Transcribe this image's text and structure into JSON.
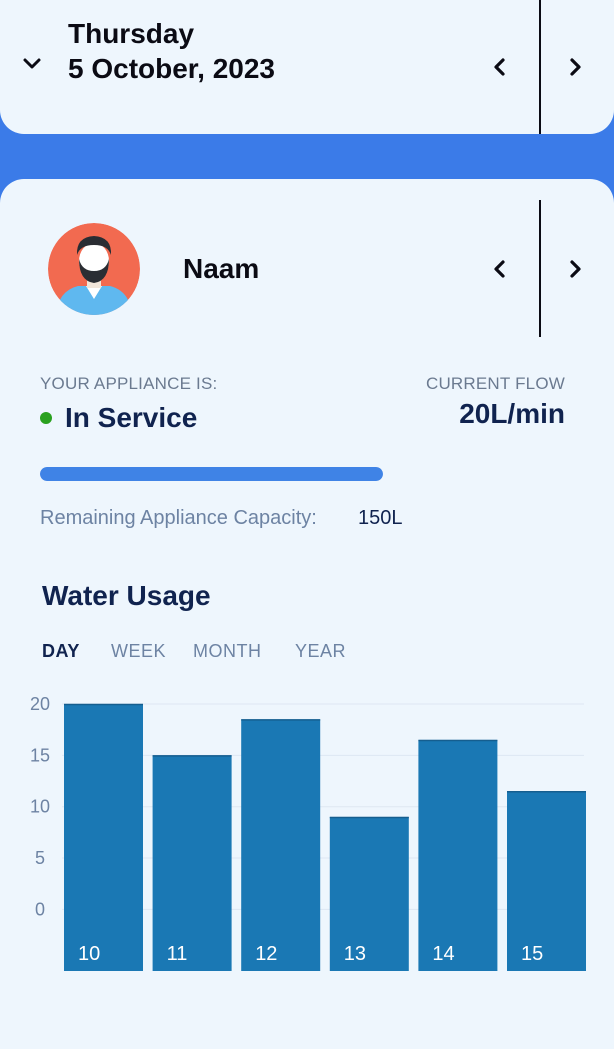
{
  "header": {
    "day": "Thursday",
    "date": "5 October, 2023"
  },
  "user": {
    "name": "Naam"
  },
  "appliance": {
    "status_label": "YOUR APPLIANCE IS:",
    "status": "In Service",
    "status_color": "#2aa11f",
    "flow_label": "CURRENT FLOW",
    "flow_value": "20L/min",
    "capacity_label": "Remaining Appliance Capacity:",
    "capacity_value": "150L",
    "capacity_fraction": 1.0
  },
  "usage": {
    "title": "Water Usage",
    "tabs": [
      "DAY",
      "WEEK",
      "MONTH",
      "YEAR"
    ],
    "active_tab": "DAY"
  },
  "colors": {
    "background": "#3b7be8",
    "card": "#eef6fd",
    "bar": "#1a78b4",
    "heading": "#10234f"
  },
  "chart_data": {
    "type": "bar",
    "categories": [
      "10",
      "11",
      "12",
      "13",
      "14",
      "15"
    ],
    "values": [
      20,
      15,
      18.5,
      9,
      16.5,
      11.5
    ],
    "ylim": [
      -6,
      20
    ],
    "yticks": [
      20,
      15,
      10,
      5,
      0
    ],
    "grid": true
  }
}
